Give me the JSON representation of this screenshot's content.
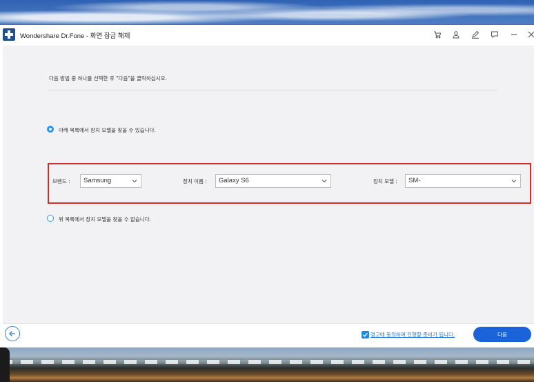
{
  "window": {
    "title": "Wondershare Dr.Fone - 화면 잠금 해제",
    "toolbar_icons": [
      "cart-icon",
      "user-icon",
      "pen-icon",
      "chat-icon",
      "minimize-icon",
      "close-icon"
    ]
  },
  "main": {
    "instruction": "다음 방법 중 하나를 선택한 후 \"다음\"을 클릭하십시오.",
    "option_found": {
      "label": "아래 목록에서 장치 모델을 찾을 수 있습니다.",
      "selected": true
    },
    "option_not_found": {
      "label": "위 목록에서 장치 모델을 찾을 수 없습니다.",
      "selected": false
    },
    "brand": {
      "label": "브랜드 :",
      "value": "Samsung"
    },
    "device_name": {
      "label": "장치 이름 :",
      "value": "Galaxy S6"
    },
    "device_model": {
      "label": "장치 모델 :",
      "value": "SM-"
    }
  },
  "footer": {
    "consent_text": "경고에 동의하며 진행할 준비가 됩니다.",
    "consent_checked": true,
    "next_label": "다음"
  },
  "colors": {
    "accent": "#1a63d8",
    "highlight_border": "#d22c2c",
    "radio": "#2196f3"
  }
}
